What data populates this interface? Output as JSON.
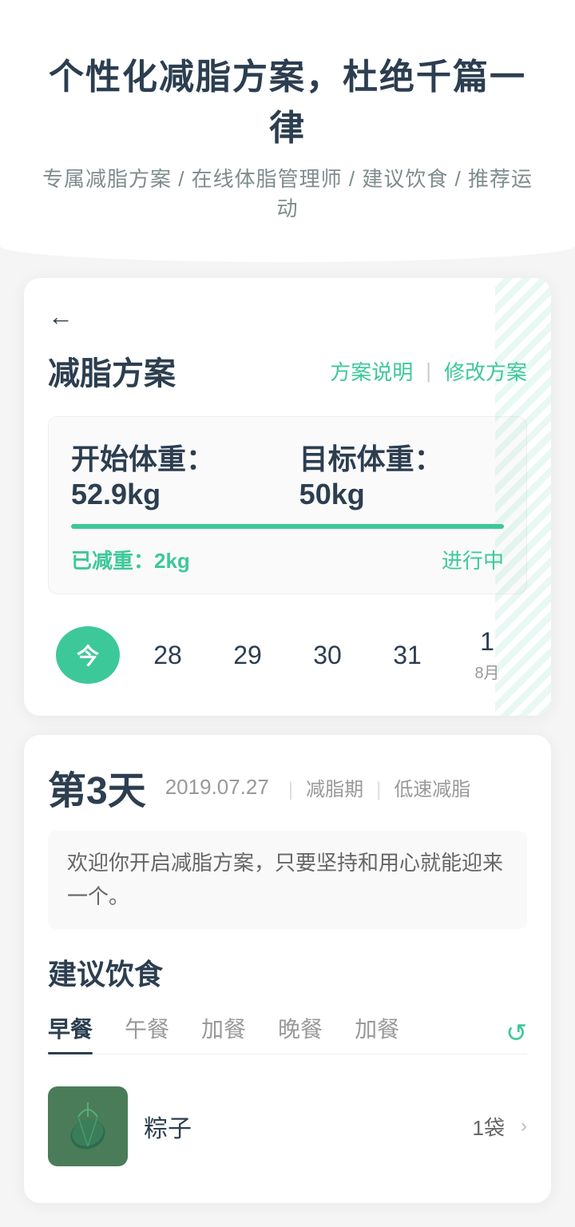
{
  "header": {
    "title": "个性化减脂方案，杜绝千篇一律",
    "subtitle": "专属减脂方案 / 在线体脂管理师 / 建议饮食 / 推荐运动"
  },
  "card": {
    "back_icon": "←",
    "title": "减脂方案",
    "action_explain": "方案说明",
    "action_divider": "|",
    "action_modify": "修改方案",
    "weight_start_label": "开始体重：",
    "weight_start_value": "52.9kg",
    "weight_target_label": "目标体重：",
    "weight_target_value": "50kg",
    "weight_lost_label": "已减重：",
    "weight_lost_value": "2kg",
    "status": "进行中"
  },
  "calendar": {
    "today_label": "今",
    "days": [
      "28",
      "29",
      "30",
      "31"
    ],
    "next_month_day": "1",
    "next_month_label": "8月"
  },
  "day_section": {
    "day_number": "第3天",
    "date": "2019.07.27",
    "tag1": "减脂期",
    "tag2": "低速减脂",
    "message": "欢迎你开启减脂方案，只要坚持和用心就能迎来一个。"
  },
  "diet_section": {
    "title": "建议饮食",
    "tabs": [
      {
        "label": "早餐",
        "active": true
      },
      {
        "label": "午餐",
        "active": false
      },
      {
        "label": "加餐",
        "active": false
      },
      {
        "label": "晚餐",
        "active": false
      },
      {
        "label": "加餐",
        "active": false
      }
    ],
    "refresh_icon": "↺",
    "food_items": [
      {
        "name": "粽子",
        "qty": "1袋",
        "has_arrow": true
      }
    ]
  },
  "colors": {
    "primary": "#3dc89a",
    "text_dark": "#2c3e50",
    "text_gray": "#999",
    "text_mid": "#666"
  }
}
